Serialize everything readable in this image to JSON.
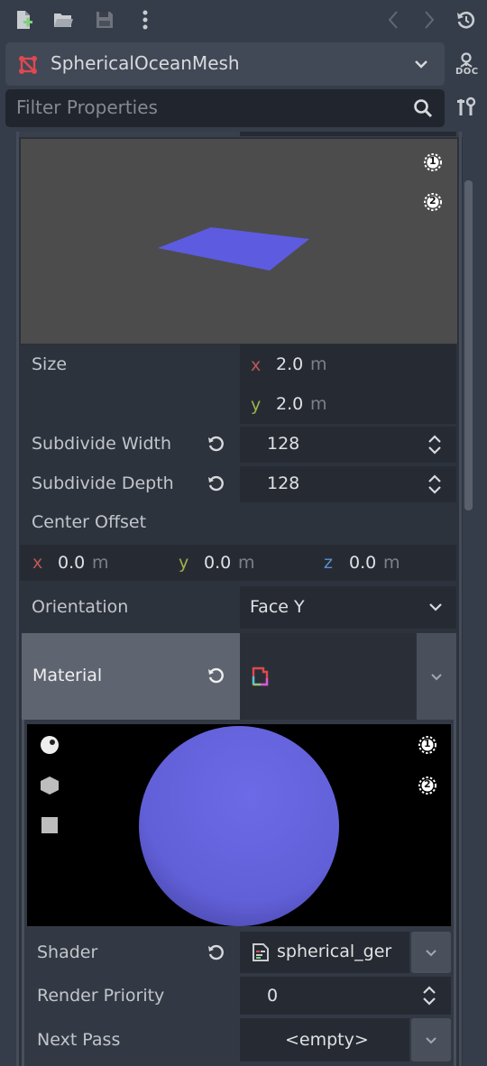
{
  "toolbar": {
    "icons": [
      "new-resource-icon",
      "open-folder-icon",
      "save-icon",
      "more-vertical-icon",
      "history-back-icon",
      "history-forward-icon",
      "history-icon"
    ]
  },
  "resource": {
    "name": "SphericalOceanMesh",
    "doc_label": "DOC"
  },
  "filter": {
    "placeholder": "Filter Properties"
  },
  "mesh_preview": {
    "light1": "1",
    "light2": "2"
  },
  "properties": {
    "size": {
      "label": "Size",
      "x_axis": "x",
      "x": "2.0",
      "y_axis": "y",
      "y": "2.0",
      "unit": "m"
    },
    "subdivide_width": {
      "label": "Subdivide Width",
      "value": "128"
    },
    "subdivide_depth": {
      "label": "Subdivide Depth",
      "value": "128"
    },
    "center_offset": {
      "label": "Center Offset",
      "x_axis": "x",
      "x": "0.0",
      "y_axis": "y",
      "y": "0.0",
      "z_axis": "z",
      "z": "0.0",
      "unit": "m"
    },
    "orientation": {
      "label": "Orientation",
      "value": "Face Y"
    },
    "material": {
      "label": "Material"
    }
  },
  "material_preview": {
    "light1": "1",
    "light2": "2"
  },
  "material_props": {
    "shader": {
      "label": "Shader",
      "value": "spherical_ger"
    },
    "render_priority": {
      "label": "Render Priority",
      "value": "0"
    },
    "next_pass": {
      "label": "Next Pass",
      "value": "<empty>"
    }
  },
  "colors": {
    "background": "#363d4a",
    "panel": "#2d333d",
    "field": "#262b33",
    "accent_resource": "#e0484f",
    "plane": "#5d5be0",
    "sphere": "#6a68e0"
  }
}
